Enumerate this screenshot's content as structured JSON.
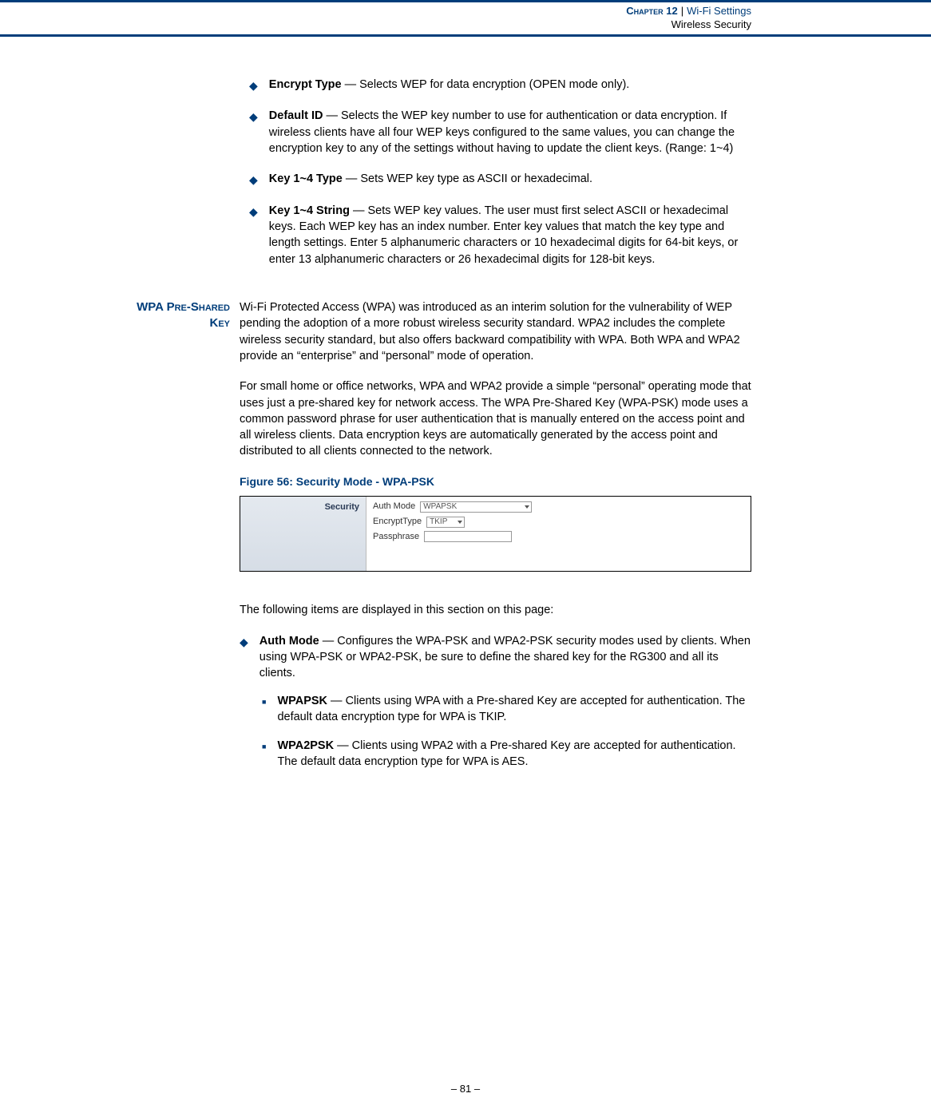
{
  "header": {
    "chapter_word": "Chapter",
    "chapter_number": "12",
    "chapter_title": "Wi-Fi Settings",
    "subtitle": "Wireless Security"
  },
  "wep_bullets": [
    {
      "term": "Encrypt Type",
      "desc": " — Selects WEP for data encryption (OPEN mode only)."
    },
    {
      "term": "Default ID",
      "desc": " — Selects the WEP key number to use for authentication or data encryption. If wireless clients have all four WEP keys configured to the same values, you can change the encryption key to any of the settings without having to update the client keys. (Range: 1~4)"
    },
    {
      "term": "Key 1~4 Type",
      "desc": " — Sets WEP key type as ASCII or hexadecimal."
    },
    {
      "term": "Key 1~4 String",
      "desc": " — Sets WEP key values. The user must first select ASCII or hexadecimal keys. Each WEP key has an index number. Enter key values that match the key type and length settings. Enter 5 alphanumeric characters or 10 hexadecimal digits for 64-bit keys, or enter 13 alphanumeric characters or 26 hexadecimal digits for 128-bit keys."
    }
  ],
  "wpa": {
    "side_heading_line1": "WPA Pre-Shared",
    "side_heading_line2": "Key",
    "para1": "Wi-Fi Protected Access (WPA) was introduced as an interim solution for the vulnerability of WEP pending the adoption of a more robust wireless security standard. WPA2 includes the complete wireless security standard, but also offers backward compatibility with WPA. Both WPA and WPA2 provide an “enterprise” and “personal” mode of operation.",
    "para2": "For small home or office networks, WPA and WPA2 provide a simple “personal” operating mode that uses just a pre-shared key for network access. The WPA Pre-Shared Key (WPA-PSK) mode uses a common password phrase for user authentication that is manually entered on the access point and all wireless clients. Data encryption keys are automatically generated by the access point and distributed to all clients connected to the network.",
    "figure_caption": "Figure 56:  Security Mode - WPA-PSK",
    "figure": {
      "panel_label": "Security",
      "auth_label": "Auth Mode",
      "auth_value": "WPAPSK",
      "encrypt_label": "EncryptType",
      "encrypt_value": "TKIP",
      "pass_label": "Passphrase"
    },
    "intro_items": "The following items are displayed in this section on this page:",
    "auth_bullet": {
      "term": "Auth Mode",
      "desc": " — Configures the WPA-PSK and WPA2-PSK security modes used by clients. When using WPA-PSK or WPA2-PSK, be sure to define the shared key for the RG300 and all its clients."
    },
    "sub_bullets": [
      {
        "term": "WPAPSK",
        "desc": " — Clients using WPA with a Pre-shared Key are accepted for authentication. The default data encryption type for WPA is TKIP."
      },
      {
        "term": "WPA2PSK",
        "desc": " — Clients using WPA2 with a Pre-shared Key are accepted for authentication. The default data encryption type for WPA is AES."
      }
    ]
  },
  "footer": "–  81  –"
}
